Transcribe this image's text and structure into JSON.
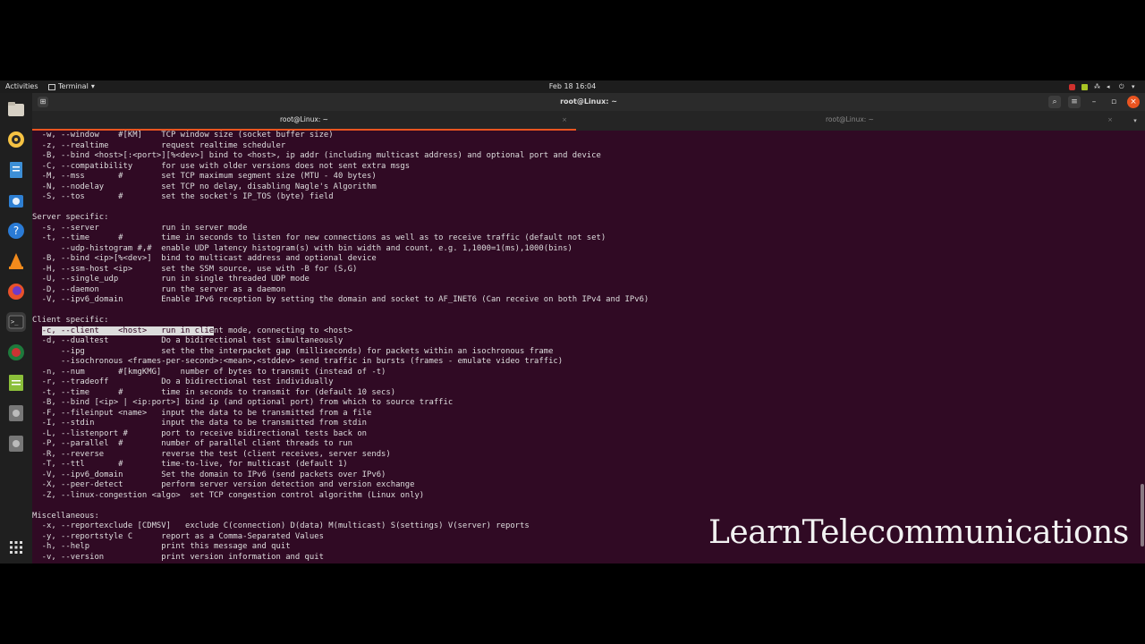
{
  "topbar": {
    "activities": "Activities",
    "app_name": "Terminal",
    "clock": "Feb 18  16:04"
  },
  "window": {
    "title": "root@Linux: ~",
    "tabs": [
      {
        "label": "root@Linux: ~"
      },
      {
        "label": "root@Linux: ~"
      }
    ]
  },
  "dock": {
    "icons": [
      "files-icon",
      "rhythmbox-icon",
      "writer-icon",
      "software-icon",
      "help-icon",
      "vlc-icon",
      "firefox-icon",
      "terminal-icon",
      "browser-icon",
      "text-editor-icon",
      "disc-icon",
      "disc-icon",
      "apps-grid-icon"
    ]
  },
  "terminal": {
    "lines": [
      "  -w, --window    #[KM]    TCP window size (socket buffer size)",
      "  -z, --realtime           request realtime scheduler",
      "  -B, --bind <host>[:<port>][%<dev>] bind to <host>, ip addr (including multicast address) and optional port and device",
      "  -C, --compatibility      for use with older versions does not sent extra msgs",
      "  -M, --mss       #        set TCP maximum segment size (MTU - 40 bytes)",
      "  -N, --nodelay            set TCP no delay, disabling Nagle's Algorithm",
      "  -S, --tos       #        set the socket's IP_TOS (byte) field",
      "",
      "Server specific:",
      "  -s, --server             run in server mode",
      "  -t, --time      #        time in seconds to listen for new connections as well as to receive traffic (default not set)",
      "      --udp-histogram #,#  enable UDP latency histogram(s) with bin width and count, e.g. 1,1000=1(ms),1000(bins)",
      "  -B, --bind <ip>[%<dev>]  bind to multicast address and optional device",
      "  -H, --ssm-host <ip>      set the SSM source, use with -B for (S,G)",
      "  -U, --single_udp         run in single threaded UDP mode",
      "  -D, --daemon             run the server as a daemon",
      "  -V, --ipv6_domain        Enable IPv6 reception by setting the domain and socket to AF_INET6 (Can receive on both IPv4 and IPv6)",
      "",
      "Client specific:",
      "",
      "  -d, --dualtest           Do a bidirectional test simultaneously",
      "      --ipg                set the the interpacket gap (milliseconds) for packets within an isochronous frame",
      "      --isochronous <frames-per-second>:<mean>,<stddev> send traffic in bursts (frames - emulate video traffic)",
      "  -n, --num       #[kmgKMG]    number of bytes to transmit (instead of -t)",
      "  -r, --tradeoff           Do a bidirectional test individually",
      "  -t, --time      #        time in seconds to transmit for (default 10 secs)",
      "  -B, --bind [<ip> | <ip:port>] bind ip (and optional port) from which to source traffic",
      "  -F, --fileinput <name>   input the data to be transmitted from a file",
      "  -I, --stdin              input the data to be transmitted from stdin",
      "  -L, --listenport #       port to receive bidirectional tests back on",
      "  -P, --parallel  #        number of parallel client threads to run",
      "  -R, --reverse            reverse the test (client receives, server sends)",
      "  -T, --ttl       #        time-to-live, for multicast (default 1)",
      "  -V, --ipv6_domain        Set the domain to IPv6 (send packets over IPv6)",
      "  -X, --peer-detect        perform server version detection and version exchange",
      "  -Z, --linux-congestion <algo>  set TCP congestion control algorithm (Linux only)",
      "",
      "Miscellaneous:",
      "  -x, --reportexclude [CDMSV]   exclude C(connection) D(data) M(multicast) S(settings) V(server) reports",
      "  -y, --reportstyle C      report as a Comma-Separated Values",
      "  -h, --help               print this message and quit",
      "  -v, --version            print version information and quit"
    ],
    "selected_line": {
      "prefix": "  ",
      "selected": "-c, --client    <host>   run in clie",
      "suffix": "nt mode, connecting to <host>"
    }
  },
  "watermark": "LearnTelecommunications"
}
